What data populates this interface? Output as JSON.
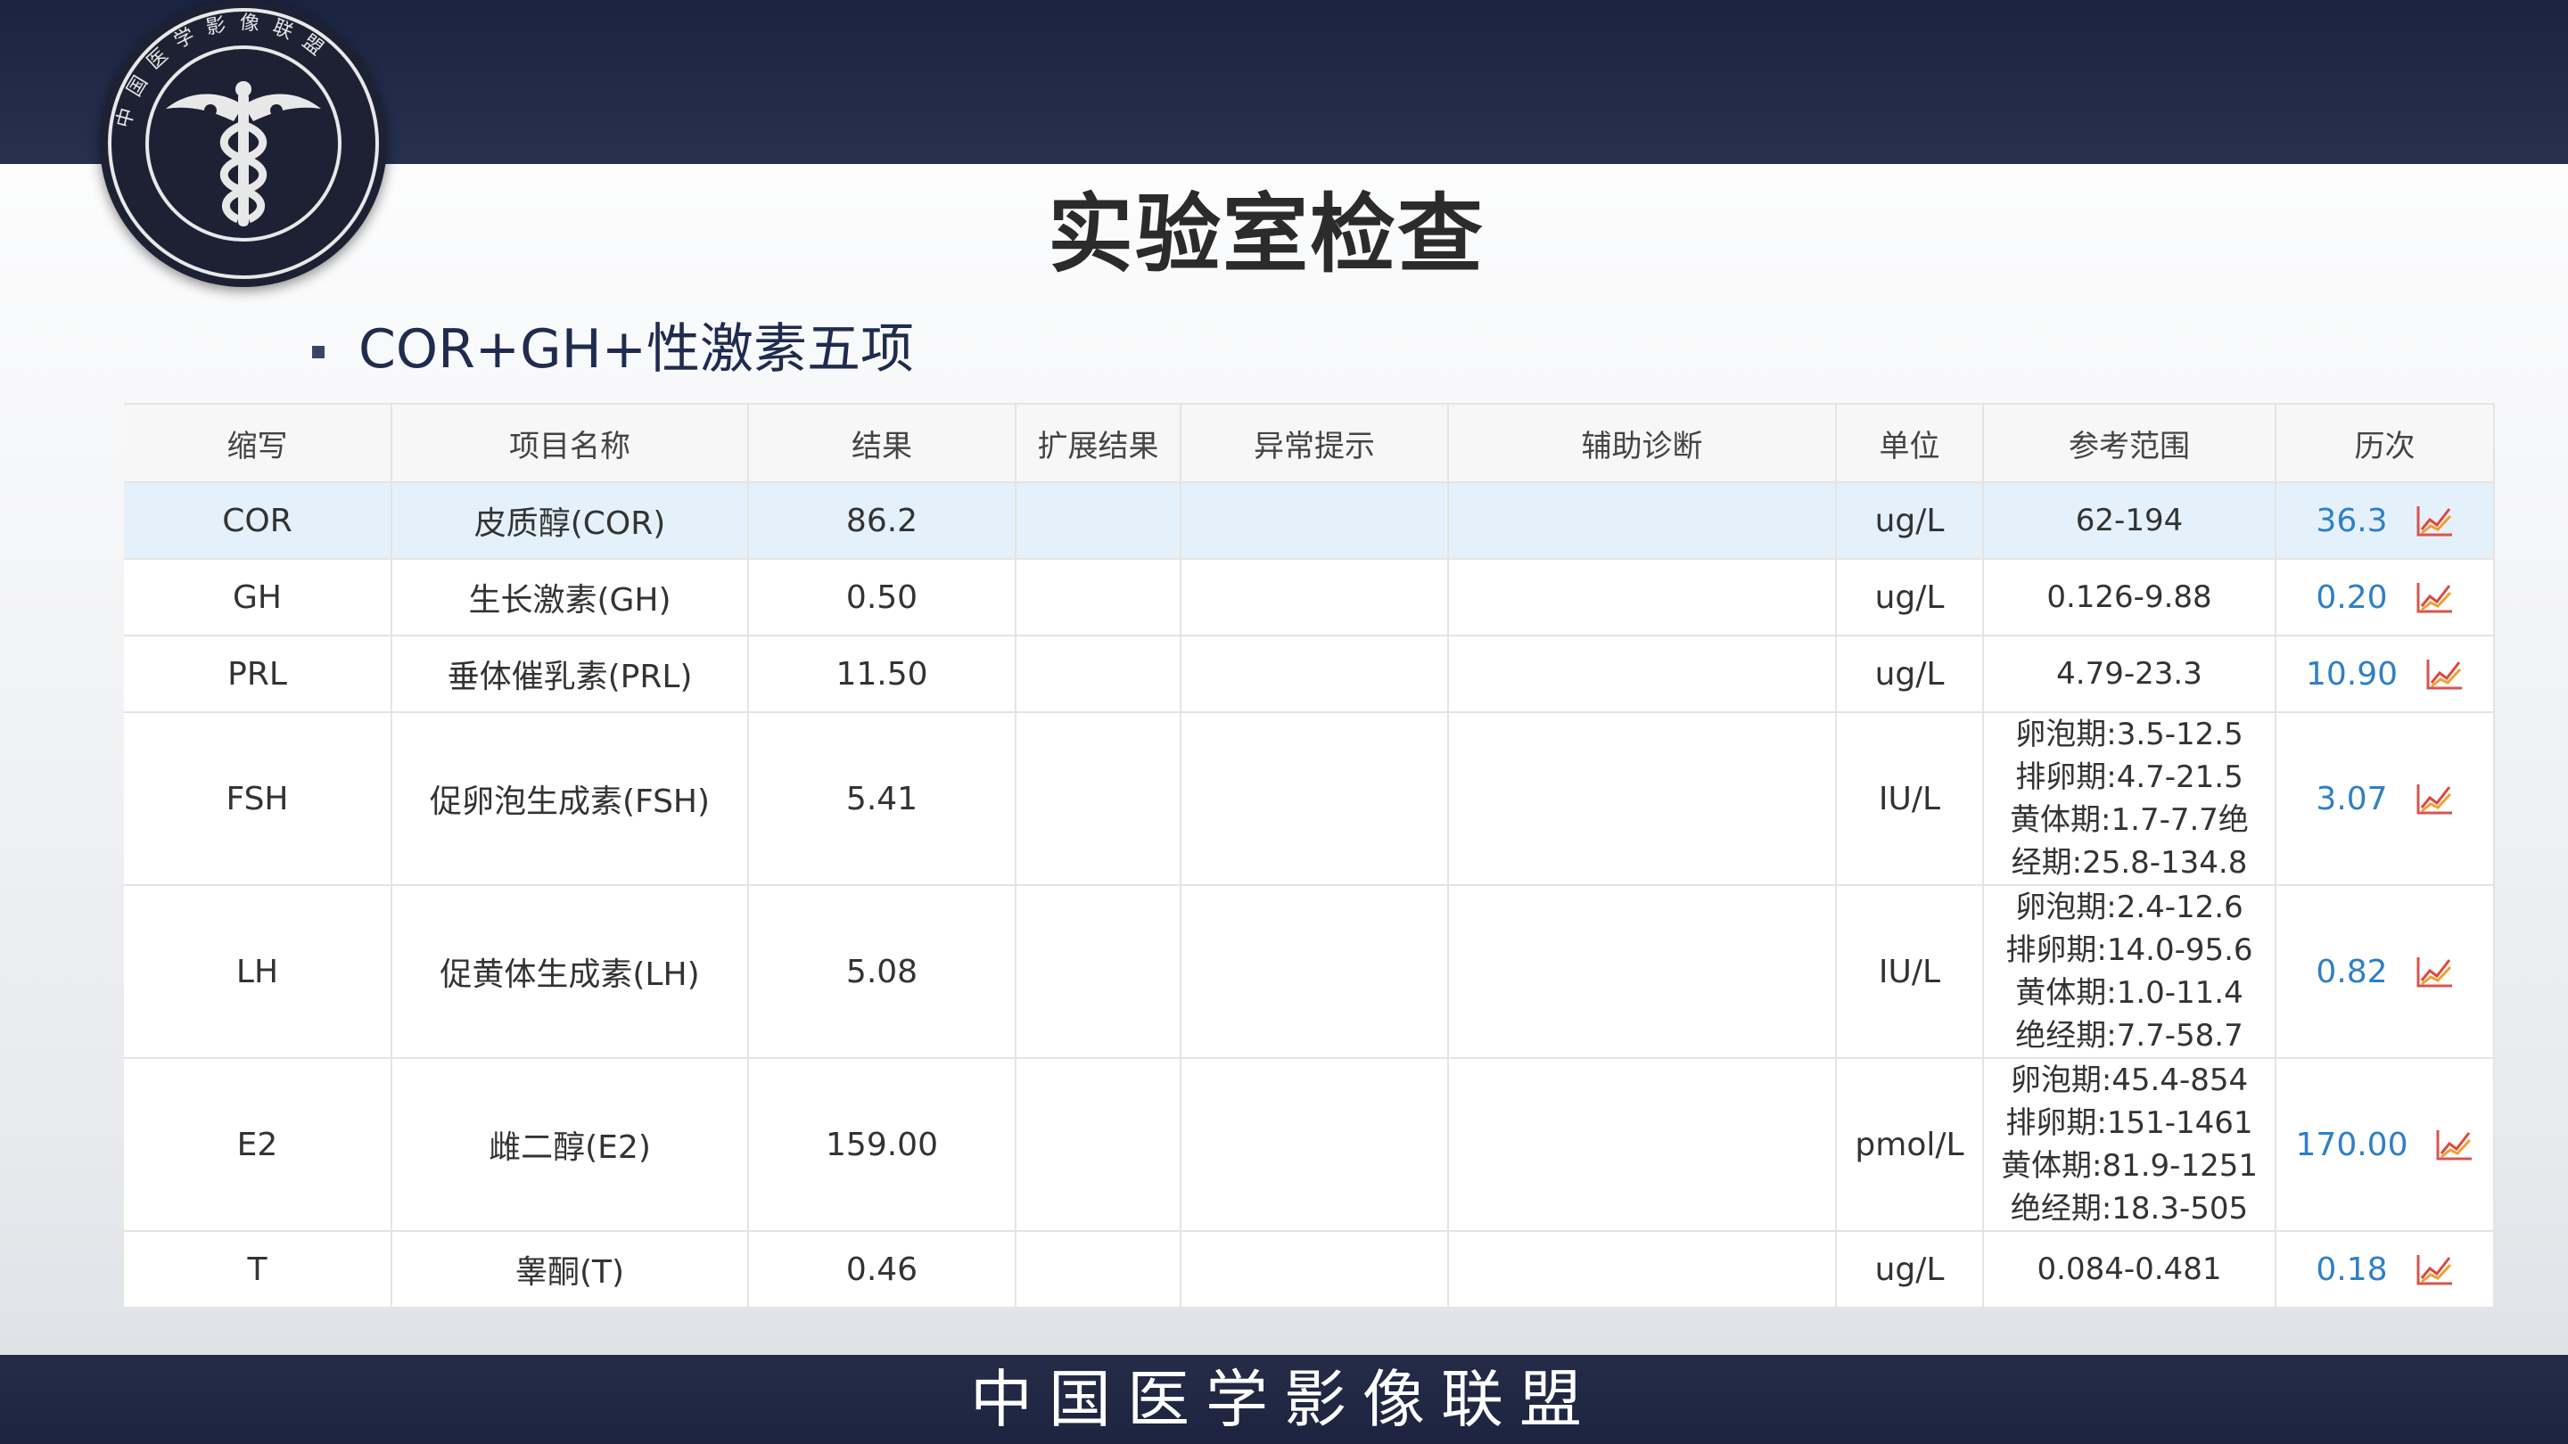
{
  "logo": {
    "icon": "caduceus-wings-emblem",
    "ring_text": "中国医学影像联盟"
  },
  "slide": {
    "title": "实验室检查",
    "subtitle": "COR+GH+性激素五项"
  },
  "table": {
    "headers": [
      "缩写",
      "项目名称",
      "结果",
      "扩展结果",
      "异常提示",
      "辅助诊断",
      "单位",
      "参考范围",
      "历次"
    ],
    "rows": [
      {
        "abbr": "COR",
        "name": "皮质醇(COR)",
        "result": "86.2",
        "extended": "",
        "flag": "",
        "diagnosis": "",
        "unit": "ug/L",
        "ref": [
          "62-194"
        ],
        "history": "36.3"
      },
      {
        "abbr": "GH",
        "name": "生长激素(GH)",
        "result": "0.50",
        "extended": "",
        "flag": "",
        "diagnosis": "",
        "unit": "ug/L",
        "ref": [
          "0.126-9.88"
        ],
        "history": "0.20"
      },
      {
        "abbr": "PRL",
        "name": "垂体催乳素(PRL)",
        "result": "11.50",
        "extended": "",
        "flag": "",
        "diagnosis": "",
        "unit": "ug/L",
        "ref": [
          "4.79-23.3"
        ],
        "history": "10.90"
      },
      {
        "abbr": "FSH",
        "name": "促卵泡生成素(FSH)",
        "result": "5.41",
        "extended": "",
        "flag": "",
        "diagnosis": "",
        "unit": "IU/L",
        "ref": [
          "卵泡期:3.5-12.5",
          "排卵期:4.7-21.5",
          "黄体期:1.7-7.7绝",
          "经期:25.8-134.8"
        ],
        "history": "3.07"
      },
      {
        "abbr": "LH",
        "name": "促黄体生成素(LH)",
        "result": "5.08",
        "extended": "",
        "flag": "",
        "diagnosis": "",
        "unit": "IU/L",
        "ref": [
          "卵泡期:2.4-12.6",
          "排卵期:14.0-95.6",
          "黄体期:1.0-11.4",
          "绝经期:7.7-58.7"
        ],
        "history": "0.82"
      },
      {
        "abbr": "E2",
        "name": "雌二醇(E2)",
        "result": "159.00",
        "extended": "",
        "flag": "",
        "diagnosis": "",
        "unit": "pmol/L",
        "ref": [
          "卵泡期:45.4-854",
          "排卵期:151-1461",
          "黄体期:81.9-1251",
          "绝经期:18.3-505"
        ],
        "history": "170.00"
      },
      {
        "abbr": "T",
        "name": "睾酮(T)",
        "result": "0.46",
        "extended": "",
        "flag": "",
        "diagnosis": "",
        "unit": "ug/L",
        "ref": [
          "0.084-0.481"
        ],
        "history": "0.18"
      }
    ],
    "trend_icon": "line-chart-trend-icon",
    "selected_row": 0,
    "colors": {
      "selected_row": "#e4f1fb",
      "history_link": "#2f7fc6",
      "trend_red": "#e0473c",
      "trend_orange": "#f0a030"
    }
  },
  "footer": {
    "text": "中国医学影像联盟"
  },
  "colors": {
    "top_band": "#1a2440",
    "bottom_band": "#242c47",
    "title": "#2b2b2b",
    "subtitle": "#1f2b4f"
  }
}
